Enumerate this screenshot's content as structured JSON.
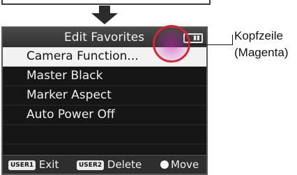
{
  "header": {
    "title": "Edit Favorites"
  },
  "menu": {
    "items": [
      {
        "label": "Camera Function..."
      },
      {
        "label": "Master Black"
      },
      {
        "label": "Marker Aspect"
      },
      {
        "label": "Auto Power Off"
      }
    ]
  },
  "footer": {
    "user1_tag": "USER1",
    "user1_action": "Exit",
    "user2_tag": "USER2",
    "user2_action": "Delete",
    "move_action": "Move"
  },
  "annotation": {
    "line1": "Kopfzeile",
    "line2": "(Magenta)",
    "circle_color": "#d8242f"
  },
  "icons": {
    "down_arrow": "down-arrow-icon",
    "battery": "battery-icon",
    "move_dot": "dial-dot-icon"
  }
}
